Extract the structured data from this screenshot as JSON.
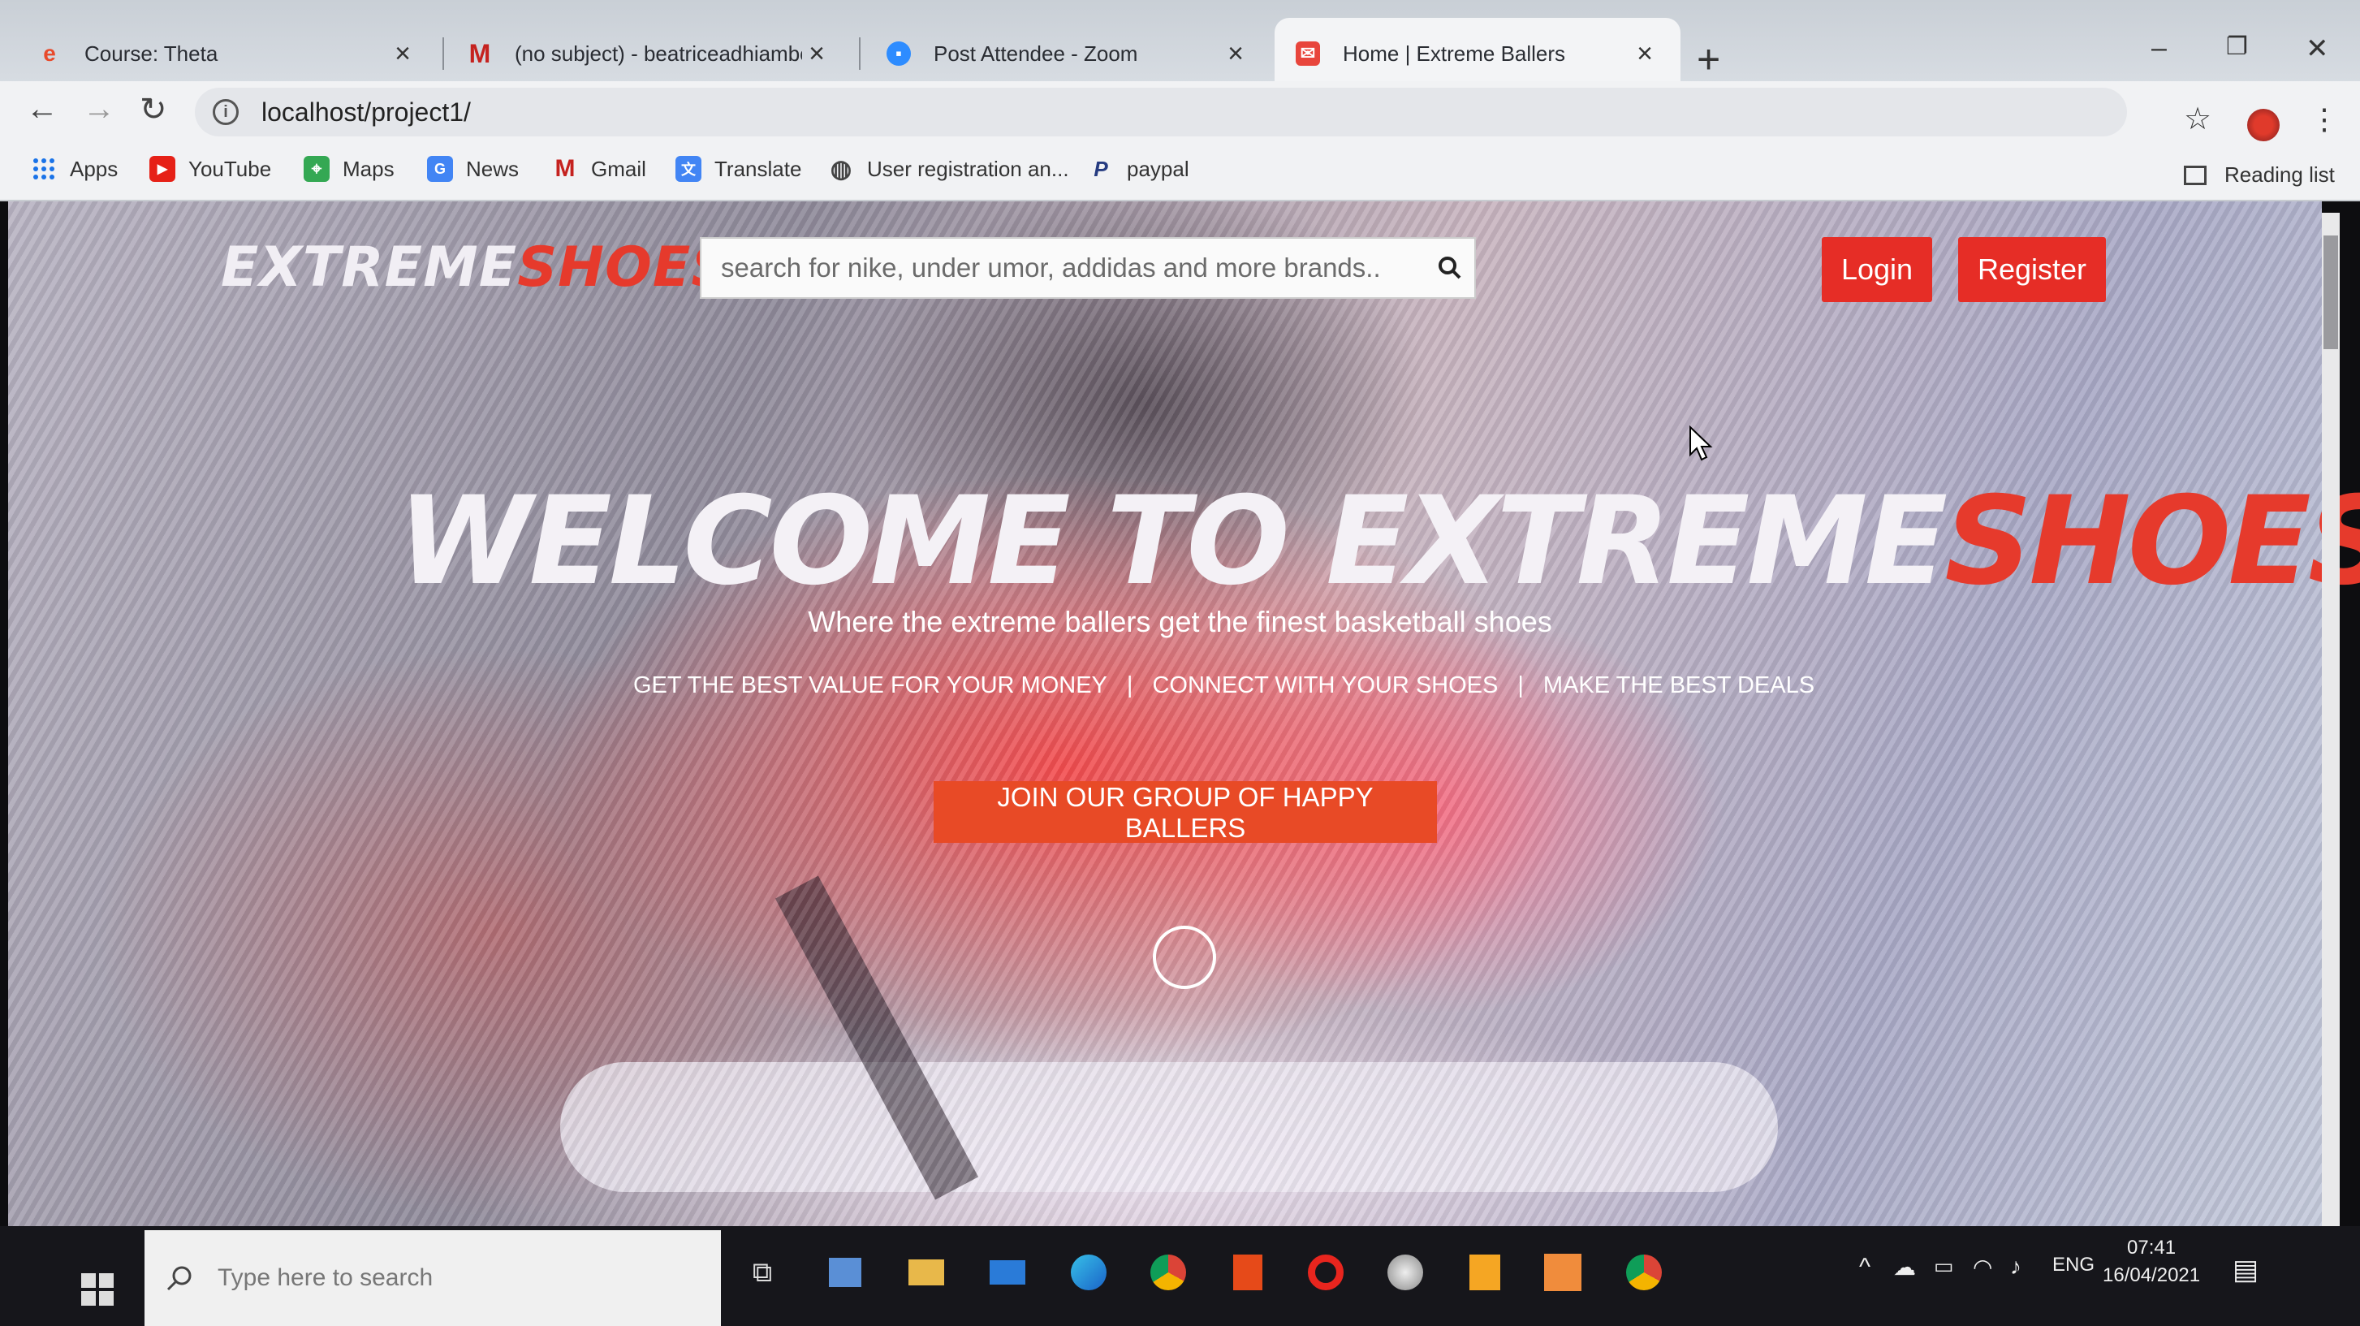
{
  "browser": {
    "tabs": [
      {
        "title": "Course: Theta",
        "icon": "theta-favicon-icon",
        "color": "#e84a2b"
      },
      {
        "title": "(no subject) - beatriceadhiambo",
        "icon": "gmail-icon",
        "color": "#c5221f"
      },
      {
        "title": "Post Attendee - Zoom",
        "icon": "zoom-icon",
        "color": "#2d8cff"
      },
      {
        "title": "Home | Extreme Ballers",
        "icon": "extreme-ballers-favicon-icon",
        "color": "#e8453c",
        "active": true
      }
    ],
    "url": "localhost/project1/",
    "bookmarks": [
      {
        "label": "Apps",
        "icon": "apps-grid-icon"
      },
      {
        "label": "YouTube",
        "icon": "youtube-icon"
      },
      {
        "label": "Maps",
        "icon": "maps-icon"
      },
      {
        "label": "News",
        "icon": "news-icon"
      },
      {
        "label": "Gmail",
        "icon": "gmail-icon"
      },
      {
        "label": "Translate",
        "icon": "translate-icon"
      },
      {
        "label": "User registration an...",
        "icon": "globe-icon"
      },
      {
        "label": "paypal",
        "icon": "paypal-icon"
      }
    ],
    "reading_list": "Reading list"
  },
  "site": {
    "logo_white": "EXTREME",
    "logo_red": "SHOES",
    "search_placeholder": "search for nike, under umor, addidas and more brands..",
    "login": "Login",
    "register": "Register",
    "hero_white": "WELCOME TO EXTREME",
    "hero_red": "SHOES",
    "subtitle": "Where the extreme ballers get the finest basketball shoes",
    "features": [
      "GET THE BEST VALUE FOR YOUR MONEY",
      "CONNECT WITH YOUR SHOES",
      "MAKE THE BEST DEALS"
    ],
    "feature_sep": "|",
    "cta": "JOIN OUR GROUP OF HAPPY BALLERS",
    "accent_color": "#e63a2c"
  },
  "taskbar": {
    "search_placeholder": "Type here to search",
    "language": "ENG",
    "time": "07:41",
    "date": "16/04/2021"
  }
}
